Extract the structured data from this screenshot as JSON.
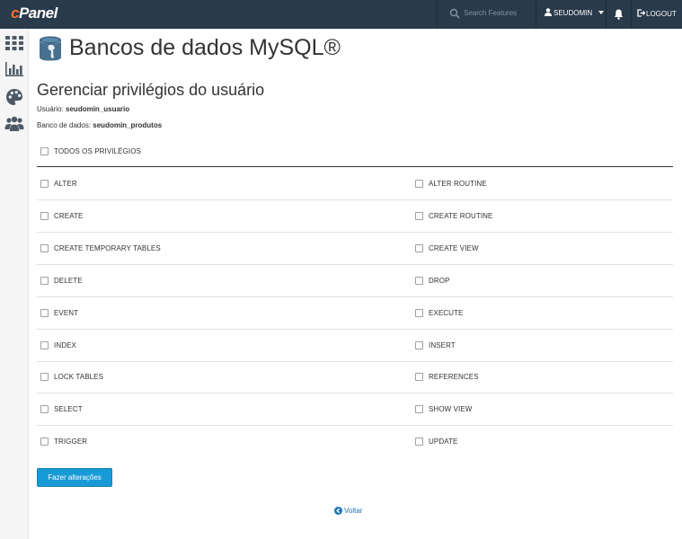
{
  "header": {
    "logo_text": "cPanel",
    "search_placeholder": "Search Features",
    "username": "SEUDOMIN",
    "logout_label": "LOGOUT"
  },
  "sidebar": {
    "icons": [
      "grid-icon",
      "stats-icon",
      "palette-icon",
      "users-icon"
    ]
  },
  "page": {
    "title": "Bancos de dados MySQL®",
    "subtitle": "Gerenciar privilégios do usuário",
    "user_label": "Usuário:",
    "user_value": "seudomin_usuario",
    "db_label": "Banco de dados:",
    "db_value": "seudomin_produtos",
    "all_privileges": "TODOS OS PRIVILÉGIOS"
  },
  "privileges": {
    "left": [
      "ALTER",
      "CREATE",
      "CREATE TEMPORARY TABLES",
      "DELETE",
      "EVENT",
      "INDEX",
      "LOCK TABLES",
      "SELECT",
      "TRIGGER"
    ],
    "right": [
      "ALTER ROUTINE",
      "CREATE ROUTINE",
      "CREATE VIEW",
      "DROP",
      "EXECUTE",
      "INSERT",
      "REFERENCES",
      "SHOW VIEW",
      "UPDATE"
    ]
  },
  "actions": {
    "submit_label": "Fazer alterações",
    "back_label": "Voltar"
  },
  "colors": {
    "topbar": "#293a4a",
    "accent": "#179bd7",
    "link": "#1f74b5",
    "logo_c": "#ff6c2c"
  }
}
